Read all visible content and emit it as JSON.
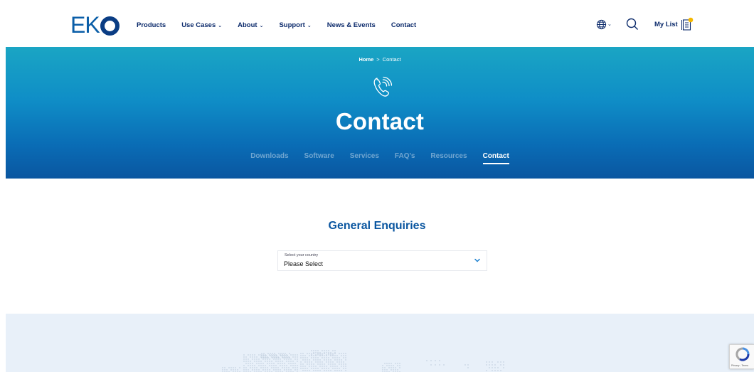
{
  "header": {
    "logo": "EKO",
    "nav": [
      {
        "label": "Products",
        "dropdown": false
      },
      {
        "label": "Use Cases",
        "dropdown": true
      },
      {
        "label": "About",
        "dropdown": true
      },
      {
        "label": "Support",
        "dropdown": true
      },
      {
        "label": "News & Events",
        "dropdown": false
      },
      {
        "label": "Contact",
        "dropdown": false
      }
    ],
    "chevron_glyph": "⌄",
    "my_list_label": "My List",
    "icons": [
      "globe-icon",
      "search-icon",
      "clipboard-list-icon"
    ]
  },
  "hero": {
    "breadcrumb": {
      "home": "Home",
      "separator": ">",
      "current": "Contact"
    },
    "title": "Contact",
    "icon": "phone-icon",
    "tabs": [
      {
        "label": "Downloads",
        "active": false
      },
      {
        "label": "Software",
        "active": false
      },
      {
        "label": "Services",
        "active": false
      },
      {
        "label": "FAQ's",
        "active": false
      },
      {
        "label": "Resources",
        "active": false
      },
      {
        "label": "Contact",
        "active": true
      }
    ]
  },
  "main": {
    "section_title": "General Enquiries",
    "country_select": {
      "label": "Select your country",
      "value": "Please Select"
    }
  },
  "recaptcha": {
    "text": "Privacy - Terms"
  },
  "colors": {
    "brand_dark": "#0b2a6b",
    "brand_blue": "#0a56a0",
    "hero_top": "#1aa5c4",
    "hero_bottom": "#0a56a0",
    "map_band": "#e8f0f9"
  }
}
